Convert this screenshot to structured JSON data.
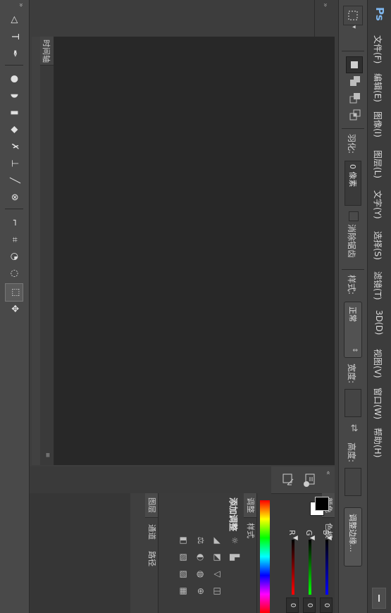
{
  "app": {
    "logo": "Ps"
  },
  "menu": [
    "文件(F)",
    "编辑(E)",
    "图像(I)",
    "图层(L)",
    "文字(Y)",
    "选择(S)",
    "滤镜(T)",
    "3D(D)",
    "视图(V)",
    "窗口(W)",
    "帮助(H)"
  ],
  "options": {
    "feather_label": "羽化:",
    "feather_value": "0 像素",
    "antialias_label": "消除锯齿",
    "style_label": "样式:",
    "style_value": "正常",
    "width_label": "宽度:",
    "height_label": "高度:",
    "refine_button": "调整边缘..."
  },
  "timeline": {
    "label": "时间轴"
  },
  "panels": {
    "color_tab": "颜色",
    "swatches_tab": "色板",
    "r_label": "R",
    "g_label": "G",
    "b_label": "B",
    "r_value": "0",
    "g_value": "0",
    "b_value": "0",
    "adjust_tab": "调整",
    "styles_tab": "样式",
    "adjust_title": "添加调整",
    "layers_tab": "图层",
    "channels_tab": "通道",
    "paths_tab": "路径"
  },
  "colors": {
    "foreground": "#000000",
    "background": "#ffffff",
    "accent": "#7fb7ee"
  },
  "tools": [
    "marquee-tool",
    "lasso-tool",
    "quick-select-tool",
    "crop-tool",
    "eyedropper-tool",
    "healing-tool",
    "brush-tool",
    "stamp-tool",
    "history-brush-tool",
    "eraser-tool",
    "gradient-tool",
    "blur-tool",
    "dodge-tool",
    "pen-tool",
    "text-tool",
    "path-select-tool"
  ]
}
